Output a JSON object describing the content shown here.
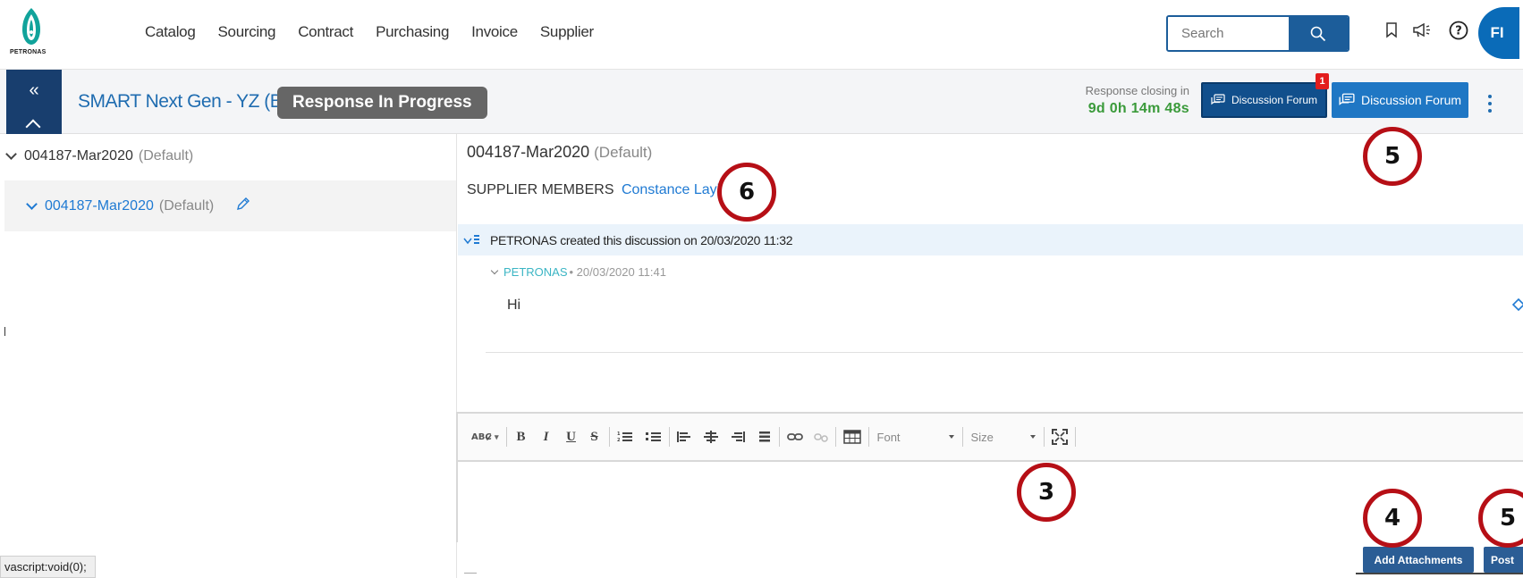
{
  "brand": {
    "logo_text": "PETRONAS",
    "primary_color": "#1f6cb0",
    "navy": "#183e6e",
    "accent_red": "#b60f16"
  },
  "nav": {
    "menu": [
      "Catalog",
      "Sourcing",
      "Contract",
      "Purchasing",
      "Invoice",
      "Supplier"
    ],
    "search_placeholder": "Search",
    "icons": [
      "bookmark-icon",
      "megaphone-icon",
      "help-icon"
    ],
    "avatar_initials": "FI"
  },
  "header": {
    "collapse_symbol": "«",
    "event_title": "SMART Next Gen - YZ (B...",
    "status": "Response In Progress",
    "closing_label": "Response closing in",
    "closing_time": "9d 0h 14m 48s",
    "forum_button_1": "Discussion Forum",
    "forum_button_2": "Discussion Forum",
    "notification_count": "1"
  },
  "tree": {
    "root": {
      "name": "004187-Mar2020",
      "tag": "(Default)"
    },
    "child": {
      "name": "004187-Mar2020",
      "tag": "(Default)"
    }
  },
  "discussion": {
    "title": "004187-Mar2020",
    "title_tag": "(Default)",
    "supplier_label": "SUPPLIER MEMBERS",
    "supplier_members": "Constance Layi...",
    "created_text": "PETRONAS created this discussion on 20/03/2020 11:32",
    "reply": {
      "author": "PETRONAS",
      "timestamp": "• 20/03/2020 11:41",
      "body": "Hi"
    }
  },
  "editor": {
    "font_label": "Font",
    "size_label": "Size",
    "buttons": {
      "bold": "B",
      "italic": "I",
      "underline": "U",
      "strike": "S"
    }
  },
  "actions": {
    "add_attachments": "Add Attachments",
    "post": "Post"
  },
  "statusbar": {
    "text": "vascript:void(0);"
  },
  "callouts": [
    "5",
    "6",
    "3",
    "4",
    "5"
  ]
}
